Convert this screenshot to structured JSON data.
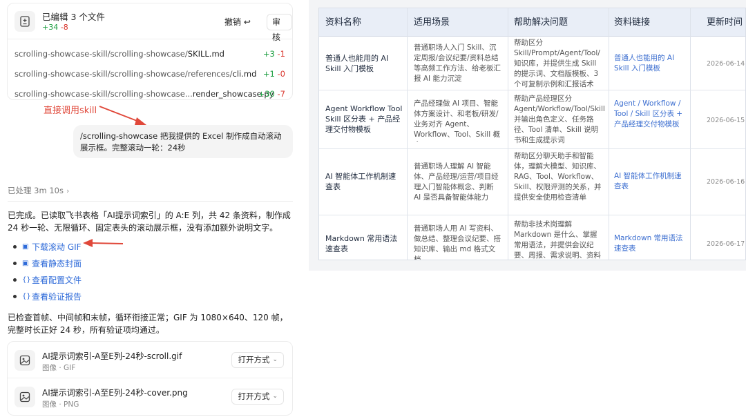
{
  "edits": {
    "title": "已编辑 3 个文件",
    "added": "+34",
    "removed": "-8",
    "undo_label": "撤销 ↩",
    "review_label": "审核",
    "files": [
      {
        "dir": "scrolling-showcase-skill/scrolling-showcase/",
        "name": "SKILL.md",
        "added": "+3",
        "removed": "-1"
      },
      {
        "dir": "scrolling-showcase-skill/scrolling-showcase/references/",
        "name": "cli.md",
        "added": "+1",
        "removed": "-0"
      },
      {
        "dir": "scrolling-showcase-skill/scrolling-showcase...",
        "name": "render_showcase.py",
        "added": "+30",
        "removed": "-7"
      }
    ]
  },
  "annotation_skill": "直接调用skill",
  "user_message": "/scrolling-showcase 把我提供的 Excel 制作成自动滚动展示框。完整滚动一轮：24秒",
  "processed_label": "已处理 3m 10s",
  "reply_para1": "已完成。已读取飞书表格「AI提示词索引」的 A:E 列，共 42 条资料，制作成 24 秒一轮、无限循环、固定表头的滚动展示框，没有添加额外说明文字。",
  "links": [
    {
      "icon": "image-icon",
      "glyph": "▣",
      "label": "下载滚动 GIF"
    },
    {
      "icon": "image-icon",
      "glyph": "▣",
      "label": "查看静态封面"
    },
    {
      "icon": "braces-icon",
      "glyph": "{}",
      "label": "查看配置文件"
    },
    {
      "icon": "braces-icon",
      "glyph": "{}",
      "label": "查看验证报告"
    }
  ],
  "reply_para2": "已检查首帧、中间帧和末帧，循环衔接正常；GIF 为 1080×640、120 帧，完整时长正好 24 秒，所有验证项均通过。",
  "attachments": [
    {
      "name": "AI提示词索引-A至E列-24秒-scroll.gif",
      "type": "图像 · GIF",
      "open_label": "打开方式"
    },
    {
      "name": "AI提示词索引-A至E列-24秒-cover.png",
      "type": "图像 · PNG",
      "open_label": "打开方式"
    }
  ],
  "table": {
    "headers": [
      "资料名称",
      "适用场景",
      "帮助解决问题",
      "资料链接",
      "更新时间"
    ],
    "rows": [
      {
        "name": "普通人也能用的 AI Skill 入门模板",
        "scene": "普通职场人入门 Skill、沉定周报/会议纪要/资料总结等高频工作方法、给老板汇报 AI 能力沉淀",
        "problem": "帮助区分 Skill/Prompt/Agent/Tool/知识库，并提供生成 Skill 的提示词、文档版模板、3 个可复制示例和汇报话术",
        "link": "普通人也能用的 AI Skill 入门模板",
        "date": "2026-06-14"
      },
      {
        "name": "Agent Workflow Tool Skill 区分表 + 产品经理交付物模板",
        "scene": "产品经理做 AI 项目、智能体方案设计、和老板/研发/业务对齐 Agent、Workflow、Tool、Skill 概念",
        "problem": "帮助产品经理区分 Agent/Workflow/Tool/Skill，并输出角色定义、任务路径、Tool 清单、Skill 说明书和生成提示词",
        "link": "Agent / Workflow / Tool / Skill 区分表 + 产品经理交付物模板",
        "date": "2026-06-15"
      },
      {
        "name": "AI 智能体工作机制速查表",
        "scene": "普通职场人理解 AI 智能体、产品经理/运营/项目经理入门智能体概念、判断 AI 是否具备智能体能力",
        "problem": "帮助区分聊天助手和智能体，理解大模型、知识库、RAG、Tool、Workflow、Skill、权限评测的关系，并提供安全使用检查清单",
        "link": "AI 智能体工作机制速查表",
        "date": "2026-06-16"
      },
      {
        "name": "Markdown 常用语法速查表",
        "scene": "普通职场人用 AI 写资料、做总结、整理会议纪要、搭知识库、输出 md 格式文档",
        "problem": "帮助非技术岗理解 Markdown 是什么、掌握常用语法，并提供会议纪要、周报、需求说明、资料总结",
        "link": "Markdown 常用语法速查表",
        "date": "2026-06-17"
      }
    ]
  }
}
